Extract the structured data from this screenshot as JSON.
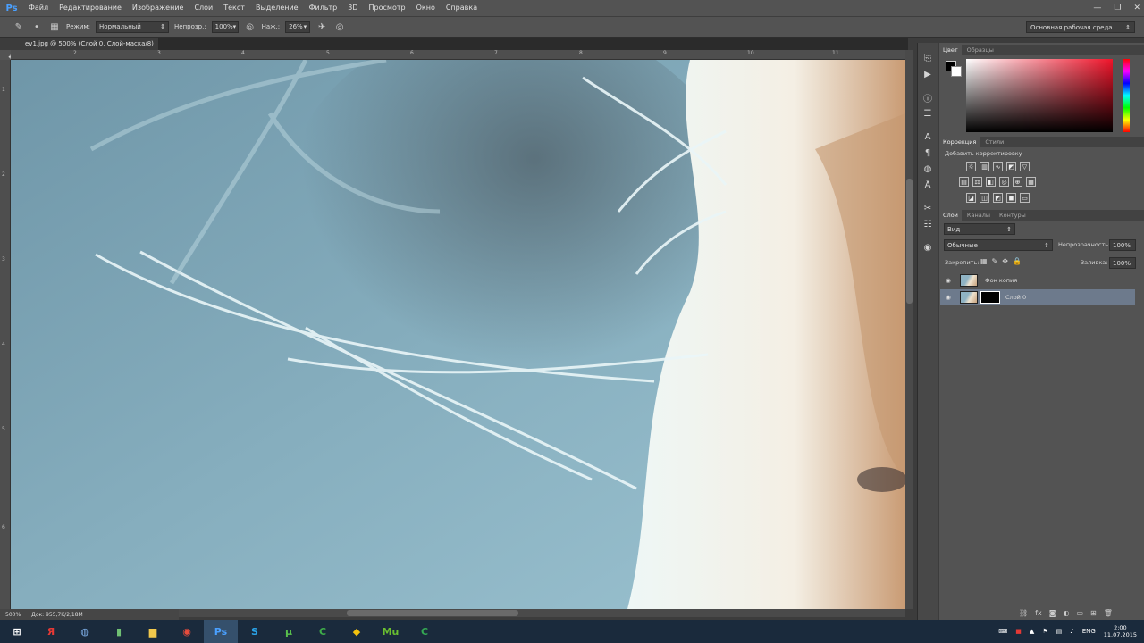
{
  "app": {
    "logo": "Ps",
    "menu": [
      "Файл",
      "Редактирование",
      "Изображение",
      "Слои",
      "Текст",
      "Выделение",
      "Фильтр",
      "3D",
      "Просмотр",
      "Окно",
      "Справка"
    ],
    "window_controls": [
      "—",
      "❐",
      "✕"
    ]
  },
  "options": {
    "mode_label": "Режим:",
    "mode_value": "Нормальный",
    "opacity_label": "Непрозр.:",
    "opacity_value": "100%",
    "pressure_label": "Наж.:",
    "pressure_value": "26%",
    "workspace": "Основная рабочая среда"
  },
  "document": {
    "tab_title": "ev1.jpg @ 500% (Слой 0, Слой-маска/8) *",
    "ruler_h": [
      "2",
      "3",
      "4",
      "5",
      "6",
      "7",
      "8",
      "9",
      "10",
      "11"
    ],
    "ruler_v": [
      "1",
      "2",
      "3",
      "4",
      "5",
      "6"
    ]
  },
  "status": {
    "zoom": "500%",
    "doc_size": "Док: 955,7K/2,18M"
  },
  "panels": {
    "color_tabs": [
      "Цвет",
      "Образцы"
    ],
    "adjust_tabs": [
      "Коррекция",
      "Стили"
    ],
    "adjust_title": "Добавить корректировку",
    "layers_tabs": [
      "Слои",
      "Каналы",
      "Контуры"
    ],
    "filter_label": "Вид",
    "blend_mode": "Обычные",
    "opacity_label": "Непрозрачность:",
    "opacity_value": "100%",
    "lock_label": "Закрепить:",
    "fill_label": "Заливка:",
    "fill_value": "100%",
    "layers": [
      {
        "name": "Фон копия"
      },
      {
        "name": "Слой 0"
      }
    ],
    "fg_color": "#000000",
    "bg_color": "#ffffff"
  },
  "taskbar": {
    "lang": "ENG",
    "time": "2:00",
    "date": "11.07.2015",
    "apps": [
      "windows-start",
      "yandex",
      "explorer-alt",
      "files",
      "folder",
      "chrome",
      "photoshop",
      "skype",
      "torrent",
      "camtasia",
      "notes",
      "muse",
      "camtasia-green"
    ]
  }
}
